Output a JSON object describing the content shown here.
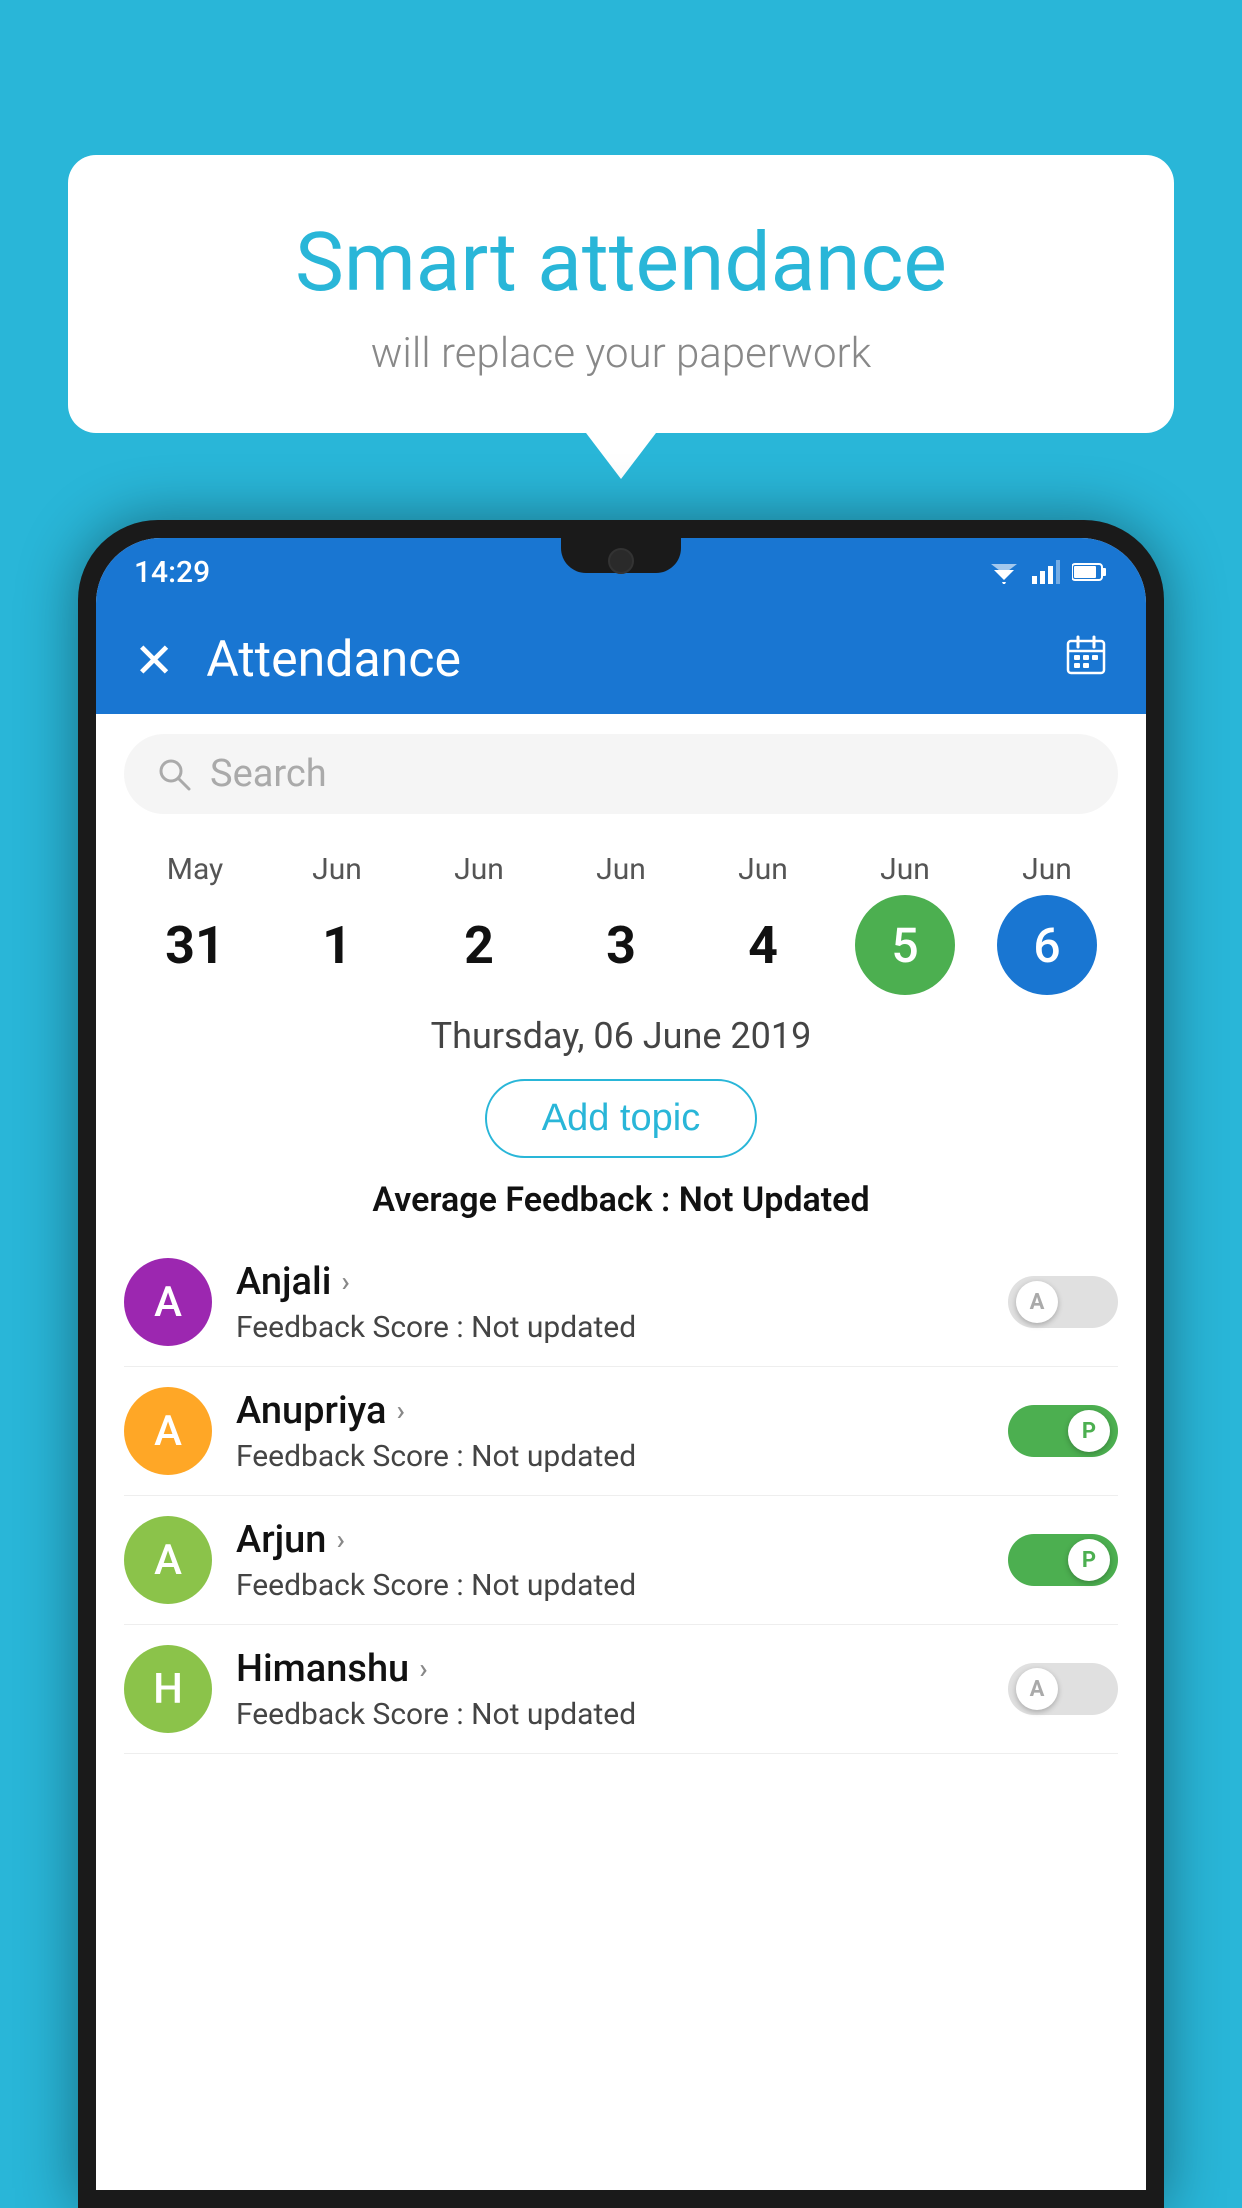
{
  "background_color": "#29b6d8",
  "speech_bubble": {
    "title": "Smart attendance",
    "subtitle": "will replace your paperwork"
  },
  "status_bar": {
    "time": "14:29"
  },
  "app_bar": {
    "title": "Attendance",
    "close_label": "✕",
    "calendar_label": "📅"
  },
  "search": {
    "placeholder": "Search"
  },
  "dates": [
    {
      "month": "May",
      "day": "31",
      "style": "normal"
    },
    {
      "month": "Jun",
      "day": "1",
      "style": "normal"
    },
    {
      "month": "Jun",
      "day": "2",
      "style": "normal"
    },
    {
      "month": "Jun",
      "day": "3",
      "style": "normal"
    },
    {
      "month": "Jun",
      "day": "4",
      "style": "normal"
    },
    {
      "month": "Jun",
      "day": "5",
      "style": "green"
    },
    {
      "month": "Jun",
      "day": "6",
      "style": "blue"
    }
  ],
  "selected_date_label": "Thursday, 06 June 2019",
  "add_topic_label": "Add topic",
  "avg_feedback_label": "Average Feedback : ",
  "avg_feedback_value": "Not Updated",
  "students": [
    {
      "name": "Anjali",
      "avatar_letter": "A",
      "avatar_color": "#9c27b0",
      "feedback_label": "Feedback Score : ",
      "feedback_value": "Not updated",
      "toggle": "off",
      "toggle_letter": "A"
    },
    {
      "name": "Anupriya",
      "avatar_letter": "A",
      "avatar_color": "#ffa726",
      "feedback_label": "Feedback Score : ",
      "feedback_value": "Not updated",
      "toggle": "on",
      "toggle_letter": "P"
    },
    {
      "name": "Arjun",
      "avatar_letter": "A",
      "avatar_color": "#8bc34a",
      "feedback_label": "Feedback Score : ",
      "feedback_value": "Not updated",
      "toggle": "on",
      "toggle_letter": "P"
    },
    {
      "name": "Himanshu",
      "avatar_letter": "H",
      "avatar_color": "#8bc34a",
      "feedback_label": "Feedback Score : ",
      "feedback_value": "Not updated",
      "toggle": "off",
      "toggle_letter": "A"
    }
  ]
}
